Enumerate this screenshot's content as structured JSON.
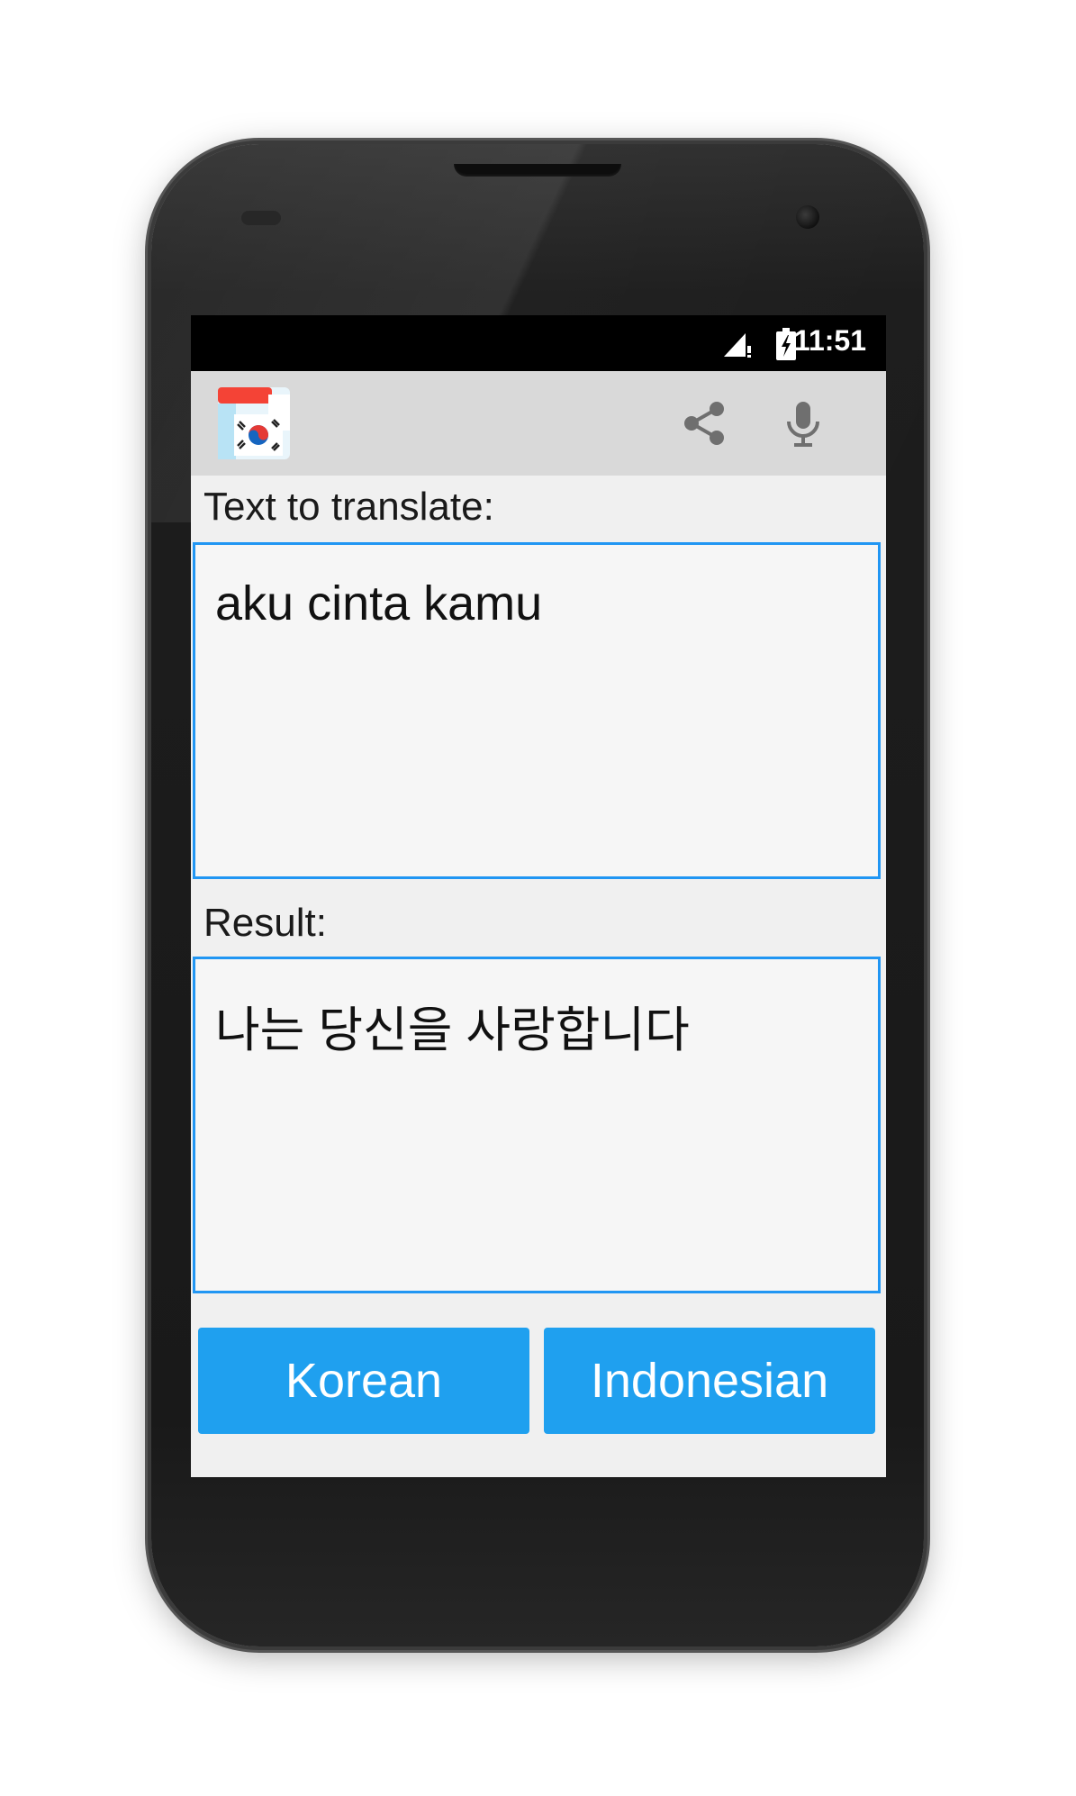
{
  "status_bar": {
    "time": "11:51"
  },
  "app": {
    "icon": "korean-flag-app-icon"
  },
  "action_bar": {
    "share_icon": "share-icon",
    "mic_icon": "microphone-icon"
  },
  "input_section": {
    "label": "Text to translate:",
    "value": "aku cinta kamu"
  },
  "result_section": {
    "label": "Result:",
    "value": "나는 당신을 사랑합니다"
  },
  "buttons": {
    "source_language": "Korean",
    "target_language": "Indonesian"
  },
  "colors": {
    "accent": "#2196f3",
    "button": "#1fa0ef",
    "action_bar": "#d9d9d9",
    "status_bar": "#000000"
  }
}
